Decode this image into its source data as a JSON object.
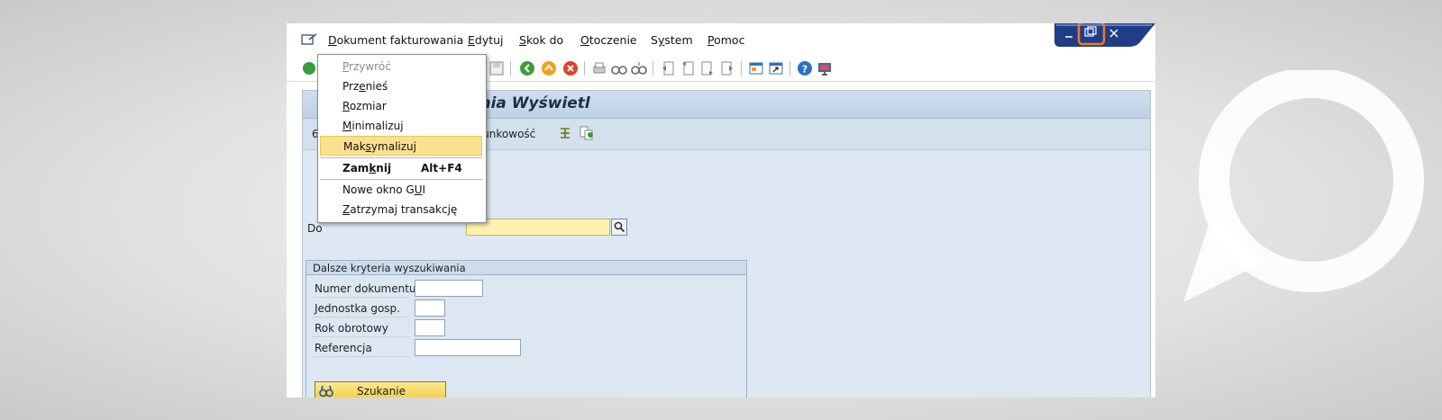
{
  "menubar": {
    "items": [
      {
        "pre": "",
        "u": "D",
        "post": "okument fakturowania"
      },
      {
        "pre": "",
        "u": "E",
        "post": "dytuj"
      },
      {
        "pre": "",
        "u": "S",
        "post": "kok do"
      },
      {
        "pre": "",
        "u": "O",
        "post": "toczenie"
      },
      {
        "pre": "S",
        "u": "y",
        "post": "stem"
      },
      {
        "pre": "",
        "u": "P",
        "post": "omoc"
      }
    ]
  },
  "dropdown": {
    "items": [
      {
        "pre": "",
        "u": "P",
        "post": "rzywróć",
        "state": "disabled"
      },
      {
        "pre": "Prz",
        "u": "e",
        "post": "nieś",
        "state": "normal"
      },
      {
        "pre": "",
        "u": "R",
        "post": "ozmiar",
        "state": "normal"
      },
      {
        "pre": "",
        "u": "M",
        "post": "inimalizuj",
        "state": "normal"
      },
      {
        "pre": "Mak",
        "u": "s",
        "post": "ymalizuj",
        "state": "highlighted"
      },
      {
        "pre": "Zam",
        "u": "k",
        "post": "nij",
        "state": "bold",
        "shortcut": "Alt+F4"
      },
      {
        "pre": "Nowe okno G",
        "u": "U",
        "post": "I",
        "state": "normal"
      },
      {
        "pre": "",
        "u": "Z",
        "post": "atrzymaj transakcję",
        "state": "normal"
      }
    ]
  },
  "content": {
    "title": "ania Wyświetl",
    "app_toolbar_left": "6",
    "app_toolbar_label": "chunkowość",
    "field_label": "Do"
  },
  "group": {
    "title": "Dalsze kryteria wyszukiwania",
    "rows": [
      {
        "label": "Numer dokumentu"
      },
      {
        "label": "Jednostka gosp."
      },
      {
        "label": "Rok obrotowy"
      },
      {
        "label": "Referencja"
      }
    ],
    "search_button": "Szukanie"
  },
  "colors": {
    "highlight": "#fbe090",
    "window_control_focus": "#f07a1d",
    "window_control_bg": "#1f3e87"
  },
  "icons": [
    "edit-icon",
    "back-icon",
    "exit-icon",
    "cancel-icon",
    "save-icon",
    "print-icon",
    "find-icon",
    "find-next-icon",
    "first-page-icon",
    "prev-page-icon",
    "next-page-icon",
    "last-page-icon",
    "new-session-icon",
    "shortcut-icon",
    "help-icon",
    "layout-icon",
    "search-help-icon",
    "binoculars-icon"
  ]
}
